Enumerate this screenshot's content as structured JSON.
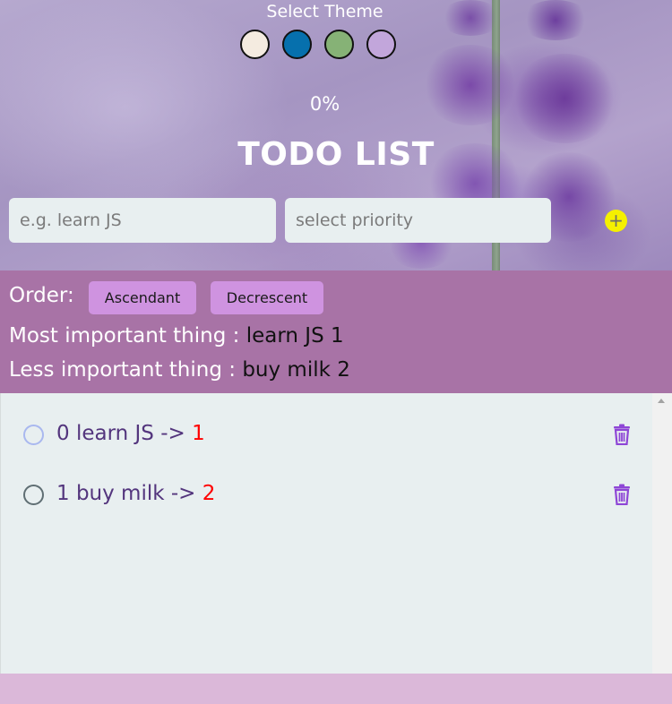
{
  "theme": {
    "title": "Select Theme",
    "swatches": [
      {
        "name": "cream",
        "color": "#f4ebe0"
      },
      {
        "name": "blue",
        "color": "#0670ad"
      },
      {
        "name": "green",
        "color": "#86b276"
      },
      {
        "name": "lavender",
        "color": "#c2a6db"
      }
    ]
  },
  "progress": "0%",
  "header": {
    "title": "TODO LIST"
  },
  "inputs": {
    "task_placeholder": "e.g. learn JS",
    "priority_placeholder": "select priority",
    "add_icon": "plus-icon",
    "add_symbol": "+"
  },
  "order": {
    "label": "Order:",
    "ascending": "Ascendant",
    "descending": "Decrescent"
  },
  "summary": {
    "most_label": "Most important thing :",
    "most_value": "learn JS 1",
    "less_label": "Less important thing :",
    "less_value": "buy milk 2"
  },
  "todos": [
    {
      "text": "0 learn JS ->",
      "priority": "1",
      "check_color": "#a9b8ef"
    },
    {
      "text": "1 buy milk ->",
      "priority": "2",
      "check_color": "#5f6e73"
    }
  ],
  "colors": {
    "order_panel": "#a873a6",
    "sort_button": "#cf93e0",
    "add_button": "#f5f000",
    "trash_icon": "#8e46d6",
    "list_background": "#e8eff0",
    "footer": "#dbb8d9"
  }
}
